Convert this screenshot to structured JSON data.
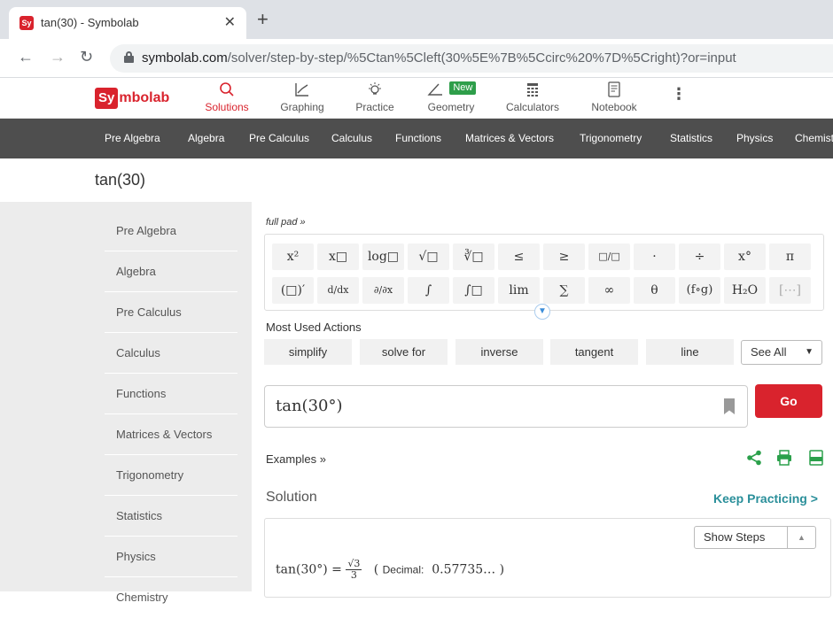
{
  "browser": {
    "tab_title": "tan(30) - Symbolab",
    "favicon_text": "Sy",
    "url_domain": "symbolab.com",
    "url_path": "/solver/step-by-step/%5Ctan%5Cleft(30%5E%7B%5Ccirc%20%7D%5Cright)?or=input"
  },
  "header": {
    "logo_sy": "Sy",
    "logo_rest": "mbolab",
    "nav": [
      {
        "label": "Solutions",
        "icon": "search-icon"
      },
      {
        "label": "Graphing",
        "icon": "graph-icon"
      },
      {
        "label": "Practice",
        "icon": "bulb-icon"
      },
      {
        "label": "Geometry",
        "icon": "angle-icon",
        "badge": "New"
      },
      {
        "label": "Calculators",
        "icon": "calculator-icon"
      },
      {
        "label": "Notebook",
        "icon": "notebook-icon"
      }
    ],
    "more": "⋮"
  },
  "subjects": [
    "Pre Algebra",
    "Algebra",
    "Pre Calculus",
    "Calculus",
    "Functions",
    "Matrices & Vectors",
    "Trigonometry",
    "Statistics",
    "Physics",
    "Chemistry"
  ],
  "page_title": "tan(30)",
  "sidebar": [
    "Pre Algebra",
    "Algebra",
    "Pre Calculus",
    "Calculus",
    "Functions",
    "Matrices & Vectors",
    "Trigonometry",
    "Statistics",
    "Physics",
    "Chemistry"
  ],
  "keypad": {
    "full_pad": "full pad »",
    "row1": [
      "x²",
      "x□",
      "log□",
      "√□",
      "∛□",
      "≤",
      "≥",
      "□/□",
      "·",
      "÷",
      "x°",
      "π"
    ],
    "row2": [
      "(□)′",
      "d/dx",
      "∂/∂x",
      "∫",
      "∫□",
      "lim",
      "∑",
      "∞",
      "θ",
      "(f∘g)",
      "H₂O",
      "[⋯]"
    ]
  },
  "most_used": {
    "label": "Most Used Actions",
    "actions": [
      "simplify",
      "solve for",
      "inverse",
      "tangent",
      "line"
    ],
    "see_all": "See All"
  },
  "input": {
    "expression": "tan(30°)",
    "go": "Go"
  },
  "examples": "Examples »",
  "solution": {
    "label": "Solution",
    "keep_practicing": "Keep Practicing >",
    "show_steps": "Show Steps",
    "lhs": "tan(30°) = ",
    "num": "√3",
    "den": "3",
    "decimal_label": "Decimal:",
    "decimal_value": "0.57735…"
  },
  "colors": {
    "brand": "#d9232d",
    "accent_green": "#2ba04b",
    "teal": "#2a8f9a"
  }
}
